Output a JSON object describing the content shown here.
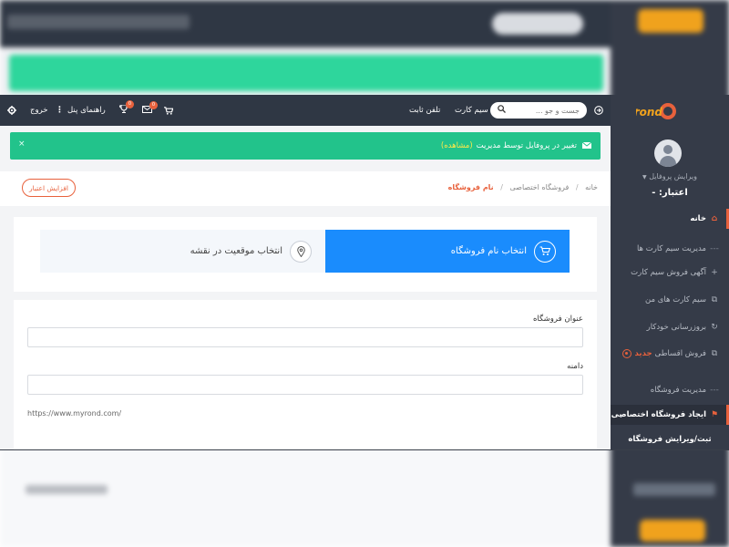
{
  "topbar": {
    "search_placeholder": "جست و جو ...",
    "sim_card": "سیم کارت",
    "landline": "تلفن ثابت",
    "panel_guide": "راهنمای پنل",
    "logout": "خروج",
    "messages_badge": "0",
    "trophy_badge": "0"
  },
  "alert": {
    "message": "تغییر در پروفایل توسط مدیریت",
    "link": "(مشاهده)",
    "close": "×"
  },
  "breadcrumb": {
    "home": "خانه",
    "separator": "/",
    "shop": "فروشگاه اختصاصی",
    "current": "نام فروشگاه"
  },
  "credit_button": "افزایش اعتبار",
  "steps": {
    "active_label": "انتخاب نام فروشگاه",
    "inactive_label": "انتخاب موقعیت در نقشه"
  },
  "form": {
    "title_label": "عنوان فروشگاه",
    "title_value": "",
    "domain_label": "دامنه",
    "domain_value": "",
    "domain_hint": "https://www.myrond.com/"
  },
  "sidebar": {
    "logo_my": "my",
    "logo_rond": "rond",
    "profile_edit": "ویرایش پروفایل",
    "credit": "اعتبار: -",
    "items": [
      {
        "label": "خانه",
        "icon": "home-icon"
      },
      {
        "label": "مدیریت سیم کارت ها",
        "icon": "dash-icon"
      },
      {
        "label": "آگهی فروش سیم کارت",
        "icon": "plus-icon"
      },
      {
        "label": "سیم کارت های من",
        "icon": "cards-icon"
      },
      {
        "label": "بروزرسانی خودکار",
        "icon": "refresh-icon"
      },
      {
        "label": "فروش اقساطی",
        "icon": "cards-icon",
        "badge": "جدید"
      },
      {
        "label": "مدیریت فروشگاه",
        "icon": "dash-icon"
      },
      {
        "label": "ایجاد فروشگاه اختصاصی",
        "icon": "flag-icon"
      },
      {
        "label": "ثبت/ویرایش فروشگاه",
        "icon": ""
      }
    ]
  },
  "colors": {
    "sidebar": "#353b48",
    "topbar": "#2f3744",
    "alert": "#22c38b",
    "accent": "#e8613c",
    "step_active": "#1a8cfd"
  }
}
